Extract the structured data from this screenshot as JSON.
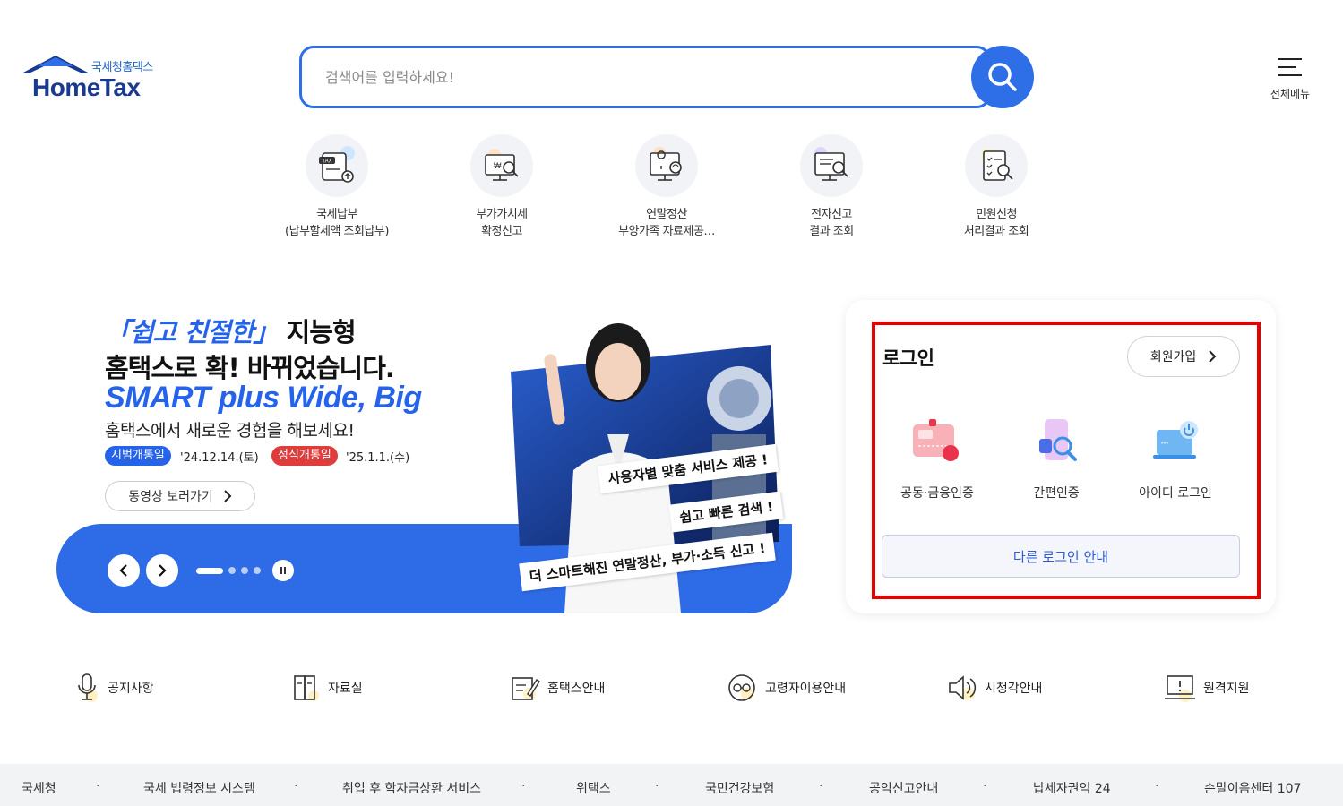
{
  "brand": {
    "kr_name": "국세청홈택스",
    "en_name": "HomeTax",
    "primary_color": "#2e6ee6",
    "navy_color": "#1a3a8f"
  },
  "search": {
    "placeholder": "검색어를 입력하세요!",
    "icon": "search-icon"
  },
  "header": {
    "all_menu_label": "전체메뉴"
  },
  "quick_menu": [
    {
      "label": "국세납부\n(납부할세액 조회납부)",
      "icon": "tax-payment-icon"
    },
    {
      "label": "부가가치세\n확정신고",
      "icon": "vat-report-icon"
    },
    {
      "label": "연말정산\n부양가족 자료제공…",
      "icon": "year-end-settlement-icon"
    },
    {
      "label": "전자신고\n결과 조회",
      "icon": "e-filing-result-icon"
    },
    {
      "label": "민원신청\n처리결과 조회",
      "icon": "civil-petition-icon"
    }
  ],
  "hero": {
    "title_highlight": "「쉽고 친절한」",
    "title_rest": " 지능형",
    "title_line2": "홈택스로 확! 바뀌었습니다.",
    "title_line3": "SMART plus Wide, Big",
    "subtitle": "홈택스에서 새로운 경험을 해보세요!",
    "badge_trial": "시범개통일",
    "date_trial": "'24.12.14.(토)",
    "badge_official": "정식개통일",
    "date_official": "'25.1.1.(수)",
    "video_button": "동영상 보러가기",
    "callout1": "사용자별 맞춤 서비스 제공 !",
    "callout2": "쉽고 빠른 검색 !",
    "callout3": "더 스마트해진 연말정산, 부가·소득 신고 !",
    "slide_count": 4,
    "active_slide": 1
  },
  "login": {
    "title": "로그인",
    "join_button": "회원가입",
    "options": [
      {
        "label": "공동·금융인증",
        "icon": "certificate-icon"
      },
      {
        "label": "간편인증",
        "icon": "simple-auth-icon"
      },
      {
        "label": "아이디 로그인",
        "icon": "id-login-icon"
      }
    ],
    "other_login": "다른 로그인 안내",
    "highlight_color": "#e60000"
  },
  "utilities": [
    {
      "label": "공지사항",
      "icon": "microphone-icon"
    },
    {
      "label": "자료실",
      "icon": "archive-icon"
    },
    {
      "label": "홈택스안내",
      "icon": "guide-icon"
    },
    {
      "label": "고령자이용안내",
      "icon": "senior-icon"
    },
    {
      "label": "시청각안내",
      "icon": "speaker-icon"
    },
    {
      "label": "원격지원",
      "icon": "remote-support-icon"
    }
  ],
  "footer_links": [
    "국세청",
    "국세 법령정보 시스템",
    "취업 후 학자금상환 서비스",
    "위택스",
    "국민건강보험",
    "공익신고안내",
    "납세자권익 24",
    "손말이음센터 107"
  ]
}
